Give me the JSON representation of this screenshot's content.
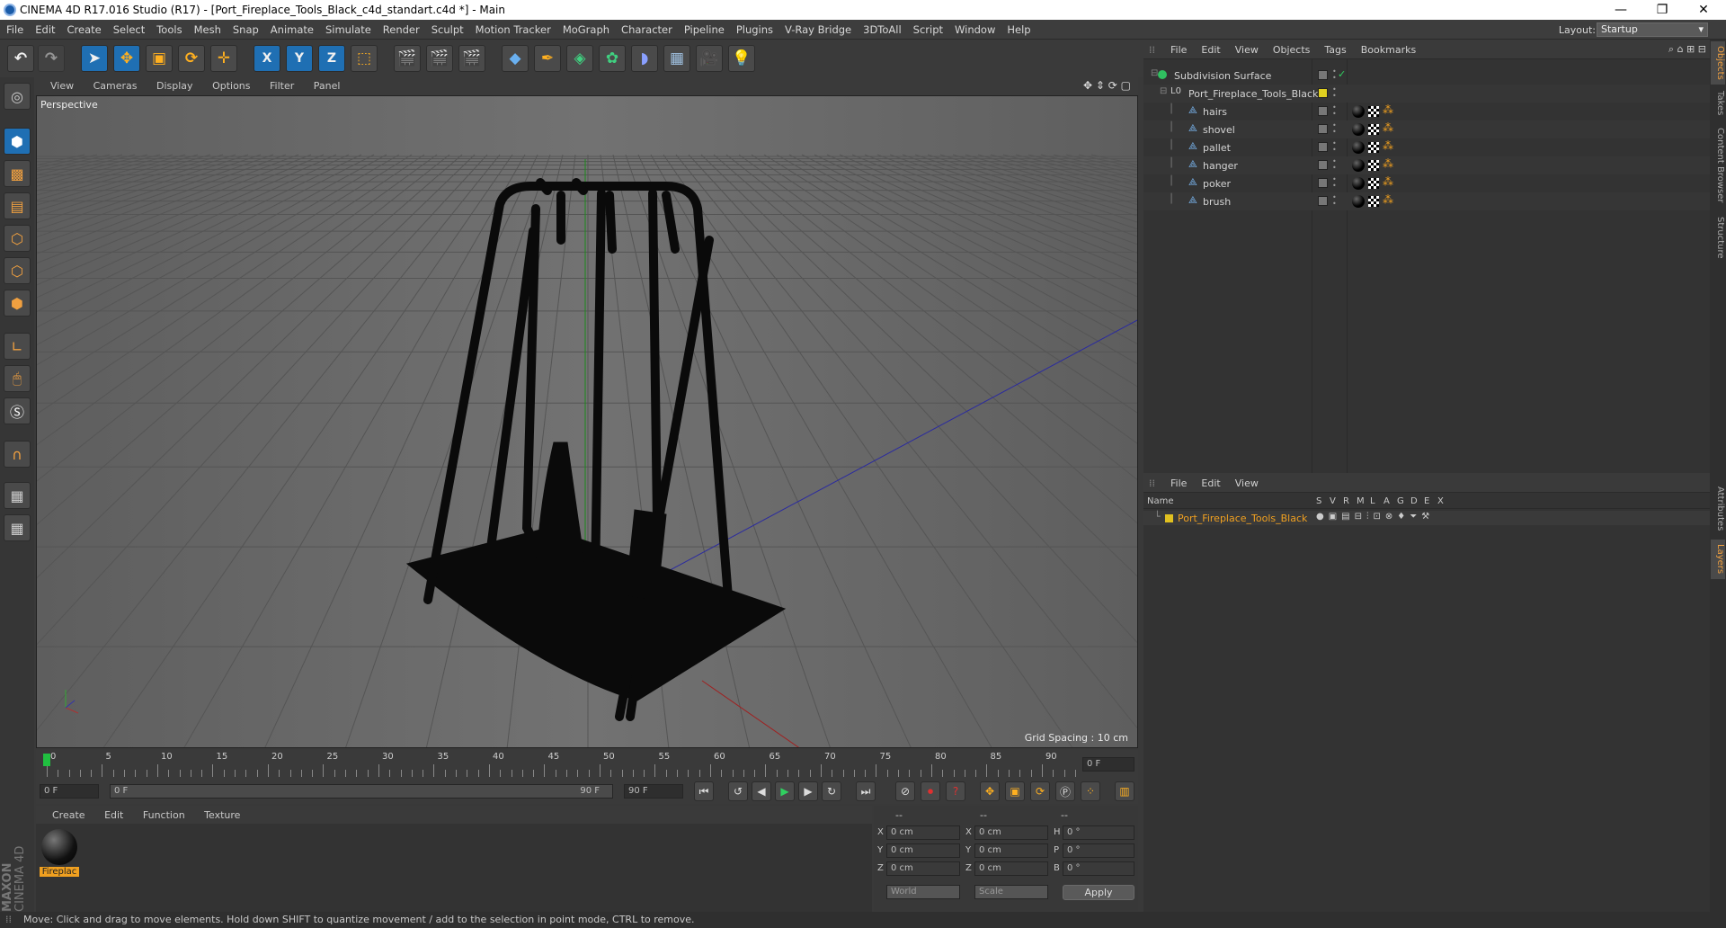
{
  "window": {
    "title": "CINEMA 4D R17.016 Studio (R17) - [Port_Fireplace_Tools_Black_c4d_standart.c4d *] - Main",
    "controls": [
      "—",
      "❐",
      "✕"
    ]
  },
  "menubar": {
    "items": [
      "File",
      "Edit",
      "Create",
      "Select",
      "Tools",
      "Mesh",
      "Snap",
      "Animate",
      "Simulate",
      "Render",
      "Sculpt",
      "Motion Tracker",
      "MoGraph",
      "Character",
      "Pipeline",
      "Plugins",
      "V-Ray Bridge",
      "3DToAll",
      "Script",
      "Window",
      "Help"
    ],
    "layout_label": "Layout:",
    "layout_value": "Startup"
  },
  "toolbar": {
    "axis_x": "X",
    "axis_y": "Y",
    "axis_z": "Z"
  },
  "viewport": {
    "menu": [
      "View",
      "Cameras",
      "Display",
      "Options",
      "Filter",
      "Panel"
    ],
    "label": "Perspective",
    "grid_spacing": "Grid Spacing : 10 cm"
  },
  "timeline": {
    "ticks": [
      "0",
      "5",
      "10",
      "15",
      "20",
      "25",
      "30",
      "35",
      "40",
      "45",
      "50",
      "55",
      "60",
      "65",
      "70",
      "75",
      "80",
      "85",
      "90"
    ],
    "current_frame": "0 F"
  },
  "playbar": {
    "start_field": "0 F",
    "range_start": "0 F",
    "range_end": "90 F",
    "end_field": "90 F"
  },
  "material_manager": {
    "menu": [
      "Create",
      "Edit",
      "Function",
      "Texture"
    ],
    "material_name": "Fireplac"
  },
  "coordinates": {
    "col_headers": [
      "--",
      "--",
      "--"
    ],
    "rows": [
      {
        "a": "X",
        "av": "0 cm",
        "b": "X",
        "bv": "0 cm",
        "c": "H",
        "cv": "0 °"
      },
      {
        "a": "Y",
        "av": "0 cm",
        "b": "Y",
        "bv": "0 cm",
        "c": "P",
        "cv": "0 °"
      },
      {
        "a": "Z",
        "av": "0 cm",
        "b": "Z",
        "bv": "0 cm",
        "c": "B",
        "cv": "0 °"
      }
    ],
    "world": "World",
    "scale": "Scale",
    "apply": "Apply"
  },
  "object_manager": {
    "menu": [
      "File",
      "Edit",
      "View",
      "Objects",
      "Tags",
      "Bookmarks"
    ],
    "objects": [
      {
        "name": "Subdivision Surface",
        "indent": 0
      },
      {
        "name": "Port_Fireplace_Tools_Black",
        "indent": 1
      },
      {
        "name": "hairs",
        "indent": 2
      },
      {
        "name": "shovel",
        "indent": 2
      },
      {
        "name": "pallet",
        "indent": 2
      },
      {
        "name": "hanger",
        "indent": 2
      },
      {
        "name": "poker",
        "indent": 2
      },
      {
        "name": "brush",
        "indent": 2
      }
    ]
  },
  "layer_manager": {
    "menu": [
      "File",
      "Edit",
      "View"
    ],
    "name_header": "Name",
    "flags": [
      "S",
      "V",
      "R",
      "M",
      "L",
      "A",
      "G",
      "D",
      "E",
      "X"
    ],
    "layer_name": "Port_Fireplace_Tools_Black",
    "layer_color": "#e0c020"
  },
  "right_tabs": [
    "Objects",
    "Takes",
    "Content Browser",
    "Structure",
    "Attributes",
    "Layers"
  ],
  "maxon": {
    "brand": "MAXON",
    "product": "CINEMA 4D"
  },
  "status": "Move: Click and drag to move elements. Hold down SHIFT to quantize movement / add to the selection in point mode, CTRL to remove."
}
